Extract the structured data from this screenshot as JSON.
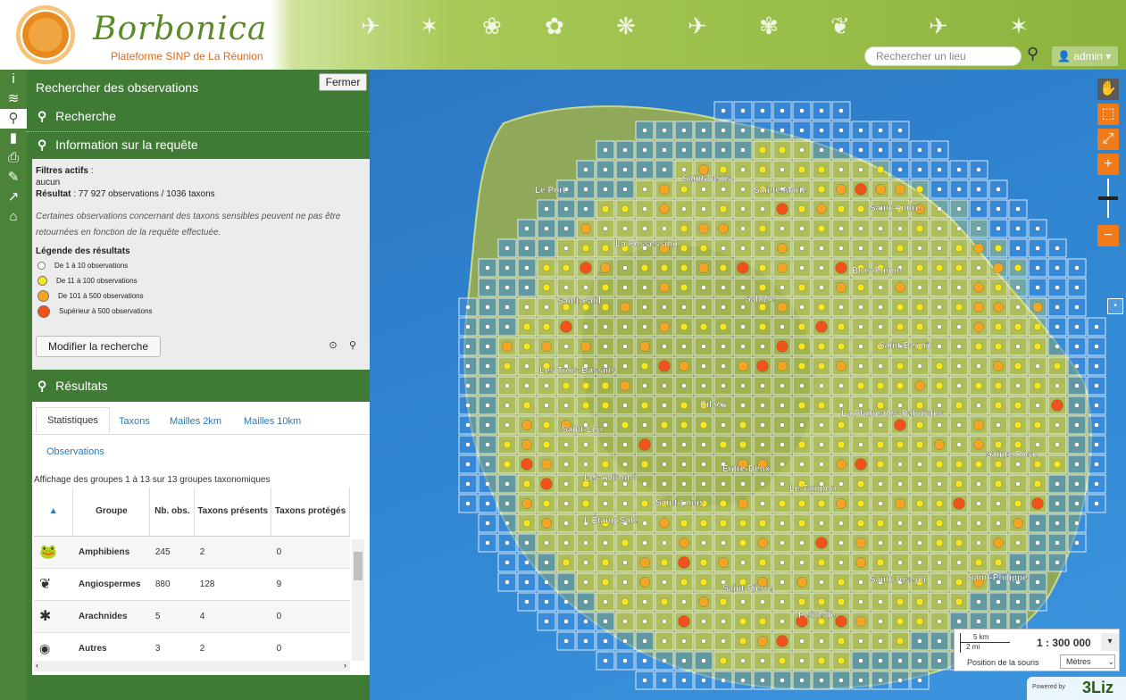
{
  "header": {
    "brand_title": "Borbonica",
    "brand_subtitle": "Plateforme SINP de La Réunion",
    "search_placeholder": "Rechercher un lieu",
    "user_label": "admin"
  },
  "left_nav": [
    "info-icon",
    "layers-icon",
    "search-icon",
    "stats-icon",
    "print-icon",
    "draw-icon",
    "share-icon",
    "education-icon"
  ],
  "panel": {
    "title": "Rechercher des observations",
    "close_label": "Fermer",
    "section_search": "Recherche",
    "section_info": "Information sur la requête",
    "filters_label": "Filtres actifs",
    "filters_value": "aucun",
    "result_label": "Résultat",
    "result_value": ": 77 927 observations / 1036 taxons",
    "sensitive_note": "Certaines observations concernant des taxons sensibles peuvent ne pas être retournées en fonction de la requête effectuée.",
    "legend_title": "Légende des résultats",
    "legend": [
      {
        "label": "De 1 à 10 observations",
        "color": "#ffffff"
      },
      {
        "label": "De 11 à 100 observations",
        "color": "#f7e81c"
      },
      {
        "label": "De 101 à 500 observations",
        "color": "#f4a623"
      },
      {
        "label": "Supérieur à 500 observations",
        "color": "#f0521a"
      }
    ],
    "modify_label": "Modifier la recherche",
    "section_results": "Résultats"
  },
  "results": {
    "tabs": [
      "Statistiques",
      "Taxons",
      "Mailles 2km",
      "Mailles 10km",
      "Observations"
    ],
    "caption": "Affichage des groupes 1 à 13 sur 13 groupes taxonomiques",
    "headers": [
      "Groupe",
      "Nb. obs.",
      "Taxons présents",
      "Taxons protégés"
    ],
    "rows": [
      {
        "icon": "frog-icon",
        "group": "Amphibiens",
        "obs": "245",
        "present": "2",
        "protected": "0"
      },
      {
        "icon": "plant-icon",
        "group": "Angiospermes",
        "obs": "880",
        "present": "128",
        "protected": "9"
      },
      {
        "icon": "spider-icon",
        "group": "Arachnides",
        "obs": "5",
        "present": "4",
        "protected": "0"
      },
      {
        "icon": "other-icon",
        "group": "Autres",
        "obs": "3",
        "present": "2",
        "protected": "0"
      }
    ]
  },
  "map": {
    "places": [
      {
        "name": "Saint-Denis"
      },
      {
        "name": "Sainte-Marie"
      },
      {
        "name": "Le Port"
      },
      {
        "name": "Saint-André"
      },
      {
        "name": "La Possession"
      },
      {
        "name": "Bras-Panon"
      },
      {
        "name": "Saint-Paul"
      },
      {
        "name": "Salazie"
      },
      {
        "name": "Saint-Benoît"
      },
      {
        "name": "Les Trois-Bassins"
      },
      {
        "name": "Cilaos"
      },
      {
        "name": "La Plaine-des-Palmistes"
      },
      {
        "name": "Saint-Leu"
      },
      {
        "name": "Sainte-Rose"
      },
      {
        "name": "Entre-Deux"
      },
      {
        "name": "Les Avirons"
      },
      {
        "name": "Le Tampon"
      },
      {
        "name": "Saint-Louis"
      },
      {
        "name": "L'Étang-Salé"
      },
      {
        "name": "Saint-Joseph"
      },
      {
        "name": "Saint-Philippe"
      },
      {
        "name": "Saint-Pierre"
      },
      {
        "name": "Petite-Île"
      }
    ],
    "scale_km": "5 km",
    "scale_mi": "2 mi",
    "scale_value": "1 : 300 000",
    "mouse_position_label": "Position de la souris",
    "units": "Mètres",
    "powered_label": "Powered by",
    "powered_brand": "3Liz"
  }
}
